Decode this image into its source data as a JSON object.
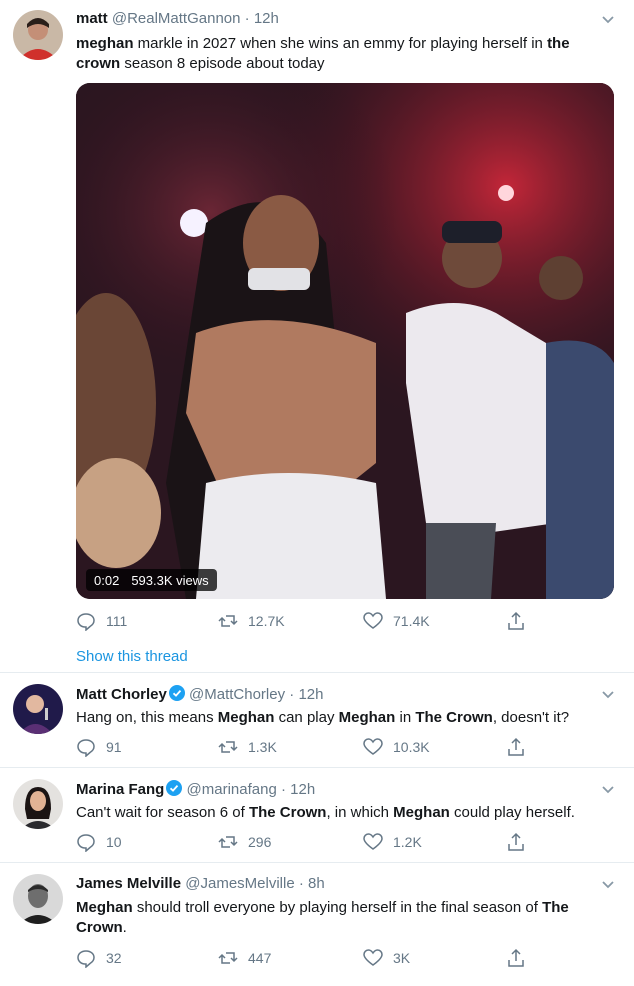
{
  "icons": {
    "reply": "reply-icon",
    "retweet": "retweet-icon",
    "like": "heart-icon",
    "share": "share-icon",
    "verified": "verified-badge-icon",
    "more": "chevron-down-icon"
  },
  "colors": {
    "link": "#1b95e0",
    "secondary": "#657786",
    "verified": "#1da1f2"
  },
  "main_tweet": {
    "name": "matt",
    "handle": "@RealMattGannon",
    "time": "12h",
    "text_runs": [
      {
        "t": "meghan",
        "b": true
      },
      {
        "t": " markle in 2027 when she wins an emmy for playing herself in ",
        "b": false
      },
      {
        "t": "the crown",
        "b": true
      },
      {
        "t": " season 8 episode about today",
        "b": false
      }
    ],
    "video": {
      "duration": "0:02",
      "views": "593.3K views"
    },
    "replies": "111",
    "retweets": "12.7K",
    "likes": "71.4K",
    "show_thread": "Show this thread"
  },
  "replies": [
    {
      "name": "Matt Chorley",
      "verified": true,
      "handle": "@MattChorley",
      "time": "12h",
      "text_runs": [
        {
          "t": "Hang on, this means ",
          "b": false
        },
        {
          "t": "Meghan",
          "b": true
        },
        {
          "t": " can play ",
          "b": false
        },
        {
          "t": "Meghan",
          "b": true
        },
        {
          "t": " in ",
          "b": false
        },
        {
          "t": "The Crown",
          "b": true
        },
        {
          "t": ", doesn't it?",
          "b": false
        }
      ],
      "replies": "91",
      "retweets": "1.3K",
      "likes": "10.3K"
    },
    {
      "name": "Marina Fang",
      "verified": true,
      "handle": "@marinafang",
      "time": "12h",
      "text_runs": [
        {
          "t": "Can't wait for season 6 of ",
          "b": false
        },
        {
          "t": "The Crown",
          "b": true
        },
        {
          "t": ", in which ",
          "b": false
        },
        {
          "t": "Meghan",
          "b": true
        },
        {
          "t": " could play herself.",
          "b": false
        }
      ],
      "replies": "10",
      "retweets": "296",
      "likes": "1.2K"
    },
    {
      "name": "James Melville",
      "verified": false,
      "handle": "@JamesMelville",
      "time": "8h",
      "text_runs": [
        {
          "t": "Meghan",
          "b": true
        },
        {
          "t": " should troll everyone by playing herself in the final season of ",
          "b": false
        },
        {
          "t": "The Crown",
          "b": true
        },
        {
          "t": ".",
          "b": false
        }
      ],
      "replies": "32",
      "retweets": "447",
      "likes": "3K"
    }
  ]
}
